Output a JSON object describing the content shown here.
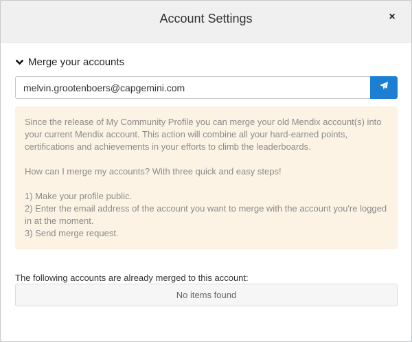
{
  "dialog": {
    "title": "Account Settings",
    "close_label": "×"
  },
  "merge": {
    "section_label": "Merge your accounts",
    "email_value": "melvin.grootenboers@capgemini.com",
    "send_icon": "paper-plane-icon",
    "accent_color": "#1d7fd4",
    "info": {
      "paragraph1": "Since the release of My Community Profile you can merge your old Mendix account(s) into your current Mendix account. This action will combine all your hard-earned points, certifications and achievements in your efforts to climb the leaderboards.",
      "question": "How can I merge my accounts? With three quick and easy steps!",
      "step1": "1) Make your profile public.",
      "step2": "2) Enter the email address of the account you want to merge with the account you're logged in at the moment.",
      "step3": "3) Send merge request."
    },
    "merged_label": "The following accounts are already merged to this account:",
    "empty_text": "No items found"
  }
}
